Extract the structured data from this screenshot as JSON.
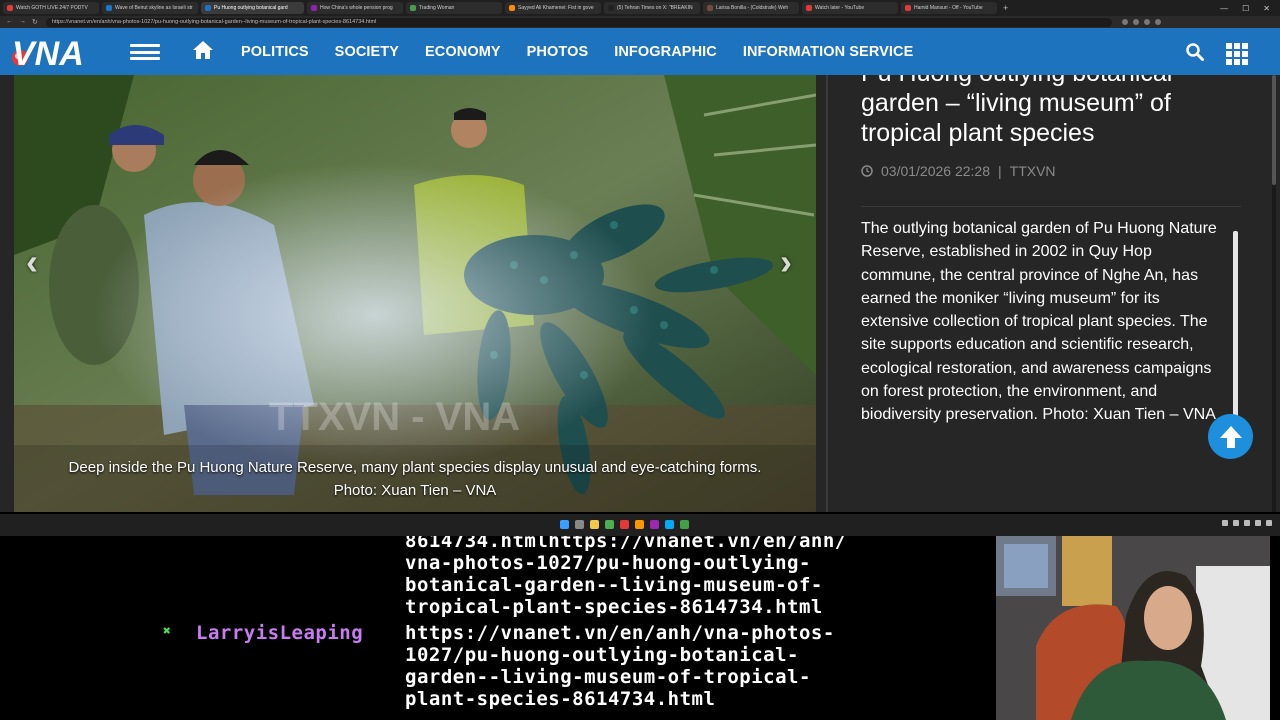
{
  "browser": {
    "tabs": [
      {
        "title": "Watch GOTH LIVE 24/7 PODTV",
        "active": false,
        "color": "#e53935"
      },
      {
        "title": "Wave of Beirut skyline as Israeli str",
        "active": false,
        "color": "#1976d2"
      },
      {
        "title": "Pu Huong outlying botanical gard",
        "active": true,
        "color": "#1e73be"
      },
      {
        "title": "How China's whole pension prog",
        "active": false,
        "color": "#8e24aa"
      },
      {
        "title": "Trading Woman",
        "active": false,
        "color": "#43a047"
      },
      {
        "title": "Sayyed Ali Khamenei: Fist in gove",
        "active": false,
        "color": "#fb8c00"
      },
      {
        "title": "(5) Tehran Times on X: \"BREAKIN",
        "active": false,
        "color": "#212121"
      },
      {
        "title": "Larisa Bonilla - (Coldstrafe) Weh",
        "active": false,
        "color": "#6d4c41"
      },
      {
        "title": "Watch later - YouTube",
        "active": false,
        "color": "#e53935"
      },
      {
        "title": "Hamid Mansuri - Off - YouTube",
        "active": false,
        "color": "#e53935"
      }
    ],
    "new_tab": "+",
    "url": "https://vnanet.vn/en/anh/vna-photos-1027/pu-huong-outlying-botanical-garden--living-museum-of-tropical-plant-species-8614734.html"
  },
  "site": {
    "logo": "VNA",
    "nav": [
      "POLITICS",
      "SOCIETY",
      "ECONOMY",
      "PHOTOS",
      "INFOGRAPHIC",
      "INFORMATION SERVICE"
    ],
    "accent": "#1e73be"
  },
  "photo": {
    "caption_line1": "Deep inside the Pu Huong Nature Reserve, many plant species display unusual and eye-catching forms.",
    "caption_line2": "Photo: Xuan Tien – VNA",
    "watermark": "TTXVN - VNA"
  },
  "article": {
    "title": "Pu Huong outlying botanical garden – “living museum” of tropical plant species",
    "date": "03/01/2026 22:28",
    "separator": "|",
    "source": "TTXVN",
    "description": "The outlying botanical garden of Pu Huong Nature Reserve, established in 2002 in Quy Hop commune, the central province of Nghe An, has earned the moniker “living museum” for its extensive collection of tropical plant species. The site supports education and scientific research, ecological restoration, and awareness campaigns on forest protection, the environment, and biodiversity preservation. Photo: Xuan Tien – VNA"
  },
  "chat": {
    "prev_message_tail": "8614734.htmlhttps://vnanet.vn/en/anh/\nvna-photos-1027/pu-huong-outlying-\nbotanical-garden--living-museum-of-\ntropical-plant-species-8614734.html",
    "username": "LarryisLeaping",
    "message": "https://vnanet.vn/en/anh/vna-photos-\n1027/pu-huong-outlying-botanical-\ngarden--living-museum-of-tropical-\nplant-species-8614734.html",
    "username_color": "#c97cf2",
    "badge_icon": "sword-badge-icon"
  }
}
